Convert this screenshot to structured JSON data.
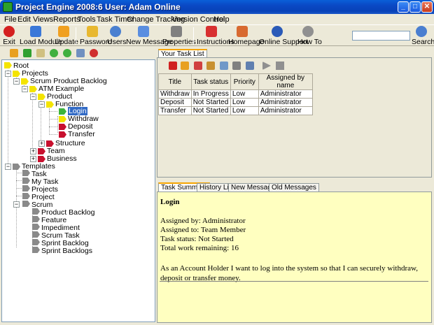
{
  "window": {
    "title": "Project Engine 2008:6  User: Adam  Online",
    "min_symbol": "_",
    "max_symbol": "□",
    "close_symbol": "✕"
  },
  "menu": {
    "items": [
      "File",
      "Edit",
      "Views",
      "Reports",
      "Tools",
      "Task Timer",
      "Change Tracking",
      "Version Control",
      "Help"
    ]
  },
  "toolbar": {
    "exit": "Exit",
    "load_module": "Load Module",
    "update": "Update",
    "password": "Password",
    "users": "Users",
    "new_message": "New Message",
    "properties": "Properties",
    "instructions": "Instructions",
    "homepage": "Homepage",
    "online_support": "Online Support",
    "how_to": "How To",
    "search": "Search",
    "search_value": ""
  },
  "tree": {
    "root": "Root",
    "projects": "Projects",
    "scrum_product_backlog": "Scrum Product Backlog",
    "atm_example": "ATM Example",
    "product": "Product",
    "function": "Function",
    "login": "Login",
    "withdraw": "Withdraw",
    "deposit": "Deposit",
    "transfer": "Transfer",
    "structure": "Structure",
    "team": "Team",
    "business": "Business",
    "templates": "Templates",
    "task": "Task",
    "my_task": "My Task",
    "t_projects": "Projects",
    "project": "Project",
    "scrum": "Scrum",
    "product_backlog": "Product Backlog",
    "feature": "Feature",
    "impediment": "Impediment",
    "scrum_task": "Scrum Task",
    "sprint_backlog": "Sprint Backlog",
    "sprint_backlogs": "Sprint Backlogs",
    "expand_plus": "+",
    "expand_minus": "−"
  },
  "task_list": {
    "tab": "Your Task List",
    "columns": [
      "Title",
      "Task status",
      "Priority",
      "Assigned by name"
    ],
    "rows": [
      [
        "Withdraw",
        "In Progress",
        "Low",
        "Administrator"
      ],
      [
        "Deposit",
        "Not Started",
        "Low",
        "Administrator"
      ],
      [
        "Transfer",
        "Not Started",
        "Low",
        "Administrator"
      ]
    ]
  },
  "detail_tabs": [
    "Task Summary",
    "History List",
    "New Messages",
    "Old Messages"
  ],
  "summary": {
    "title": "Login",
    "assigned_by": "Assigned by: Administrator",
    "assigned_to": "Assigned to: Team Member",
    "status": "Task status: Not Started",
    "work": "Total work remaining: 16",
    "description": "As an Account Holder I want to log into the system so that I can securely withdraw, deposit or transfer money."
  },
  "colors": {
    "titlebar": "#0a48c4",
    "selection": "#316ac5",
    "summary_bg": "#ffffc0",
    "active_tab": "#f5a400"
  }
}
